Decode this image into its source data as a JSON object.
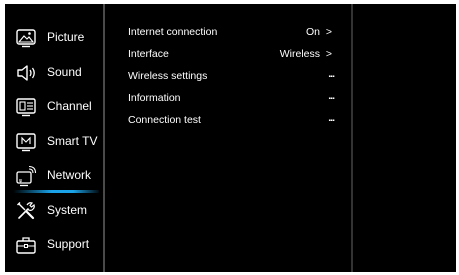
{
  "menu": {
    "items": [
      {
        "label": "Picture",
        "icon": "picture-icon"
      },
      {
        "label": "Sound",
        "icon": "speaker-icon"
      },
      {
        "label": "Channel",
        "icon": "channel-icon"
      },
      {
        "label": "Smart TV",
        "icon": "smart-tv-icon"
      },
      {
        "label": "Network",
        "icon": "network-icon",
        "selected": true
      },
      {
        "label": "System",
        "icon": "tools-icon"
      },
      {
        "label": "Support",
        "icon": "toolbox-icon"
      }
    ],
    "highlight_color": "#1aa3e8"
  },
  "network_settings": [
    {
      "label": "Internet connection",
      "value": "On",
      "arrow": ">"
    },
    {
      "label": "Interface",
      "value": "Wireless",
      "arrow": ">"
    },
    {
      "label": "Wireless settings",
      "more": "..."
    },
    {
      "label": "Information",
      "more": "..."
    },
    {
      "label": "Connection test",
      "more": "..."
    }
  ],
  "colors": {
    "background": "#000000",
    "text": "#ffffff"
  }
}
